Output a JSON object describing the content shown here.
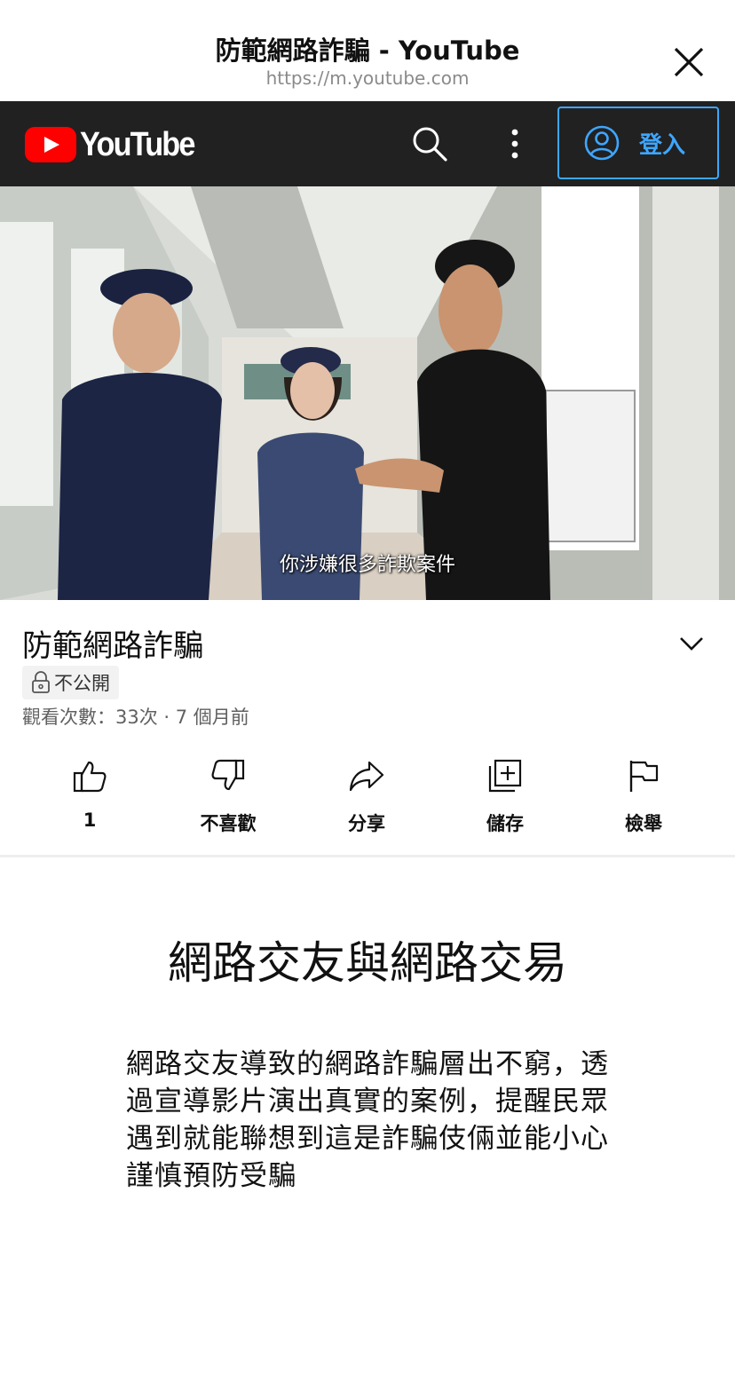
{
  "browser": {
    "page_title": "防範網路詐騙 - YouTube",
    "url": "https://m.youtube.com"
  },
  "header": {
    "logo_text": "YouTube",
    "signin_label": "登入"
  },
  "video": {
    "caption": "你涉嫌很多詐欺案件",
    "title": "防範網路詐騙",
    "privacy": "不公開",
    "meta": "觀看次數：33次 · 7 個月前"
  },
  "actions": [
    {
      "label": "1",
      "icon": "thumbs-up-icon"
    },
    {
      "label": "不喜歡",
      "icon": "thumbs-down-icon"
    },
    {
      "label": "分享",
      "icon": "share-icon"
    },
    {
      "label": "儲存",
      "icon": "save-playlist-icon"
    },
    {
      "label": "檢舉",
      "icon": "flag-icon"
    }
  ],
  "description": {
    "heading": "網路交友與網路交易",
    "body": "網路交友導致的網路詐騙層出不窮，透過宣導影片演出真實的案例，提醒民眾遇到就能聯想到這是詐騙伎倆並能小心謹慎預防受騙"
  },
  "colors": {
    "yt_red": "#ff0000",
    "header_bg": "#212121",
    "signin_blue": "#3ea6ff"
  }
}
